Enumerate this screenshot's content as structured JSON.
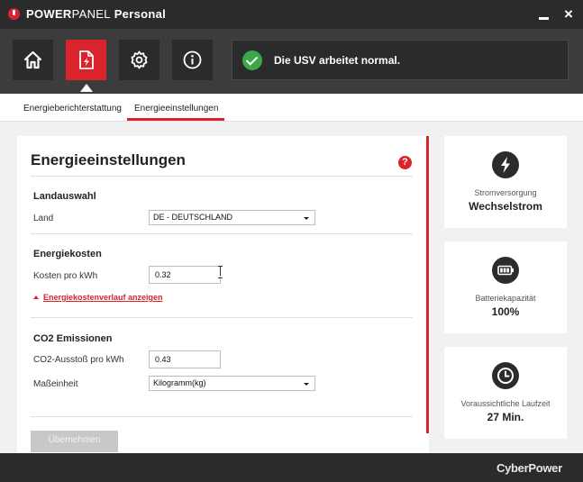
{
  "window": {
    "title_bold_1": "POWER",
    "title_regular": "PANEL",
    "title_bold_2": " Personal",
    "minimize_icon": "minimize-icon",
    "close_label": "×"
  },
  "toolbar": {
    "buttons": [
      {
        "icon": "home-icon",
        "active": false
      },
      {
        "icon": "energy-document-icon",
        "active": true
      },
      {
        "icon": "gear-icon",
        "active": false
      },
      {
        "icon": "info-icon",
        "active": false
      }
    ],
    "status_text": "Die USV arbeitet normal.",
    "status_color": "#3ca648"
  },
  "tabs": [
    {
      "label": "Energieberichterstattung",
      "active": false
    },
    {
      "label": "Energieeinstellungen",
      "active": true
    }
  ],
  "panel": {
    "title": "Energieeinstellungen",
    "help_label": "?",
    "country": {
      "section_title": "Landauswahl",
      "field_label": "Land",
      "selected": "DE - DEUTSCHLAND"
    },
    "costs": {
      "section_title": "Energiekosten",
      "field_label": "Kosten pro kWh",
      "value": "0.32",
      "history_link": "Energiekostenverlauf anzeigen"
    },
    "co2": {
      "section_title": "CO2 Emissionen",
      "field_label": "CO2-Ausstoß pro kWh",
      "value": "0.43",
      "unit_label": "Maßeinheit",
      "unit_selected": "Kilogramm(kg)"
    },
    "apply_label": "Übernehmen"
  },
  "cards": [
    {
      "icon": "lightning-icon",
      "label": "Stromversorgung",
      "value": "Wechselstrom"
    },
    {
      "icon": "battery-icon",
      "label": "Batteriekapazität",
      "value": "100%"
    },
    {
      "icon": "clock-icon",
      "label": "Voraussichtliche Laufzeit",
      "value": "27 Min."
    }
  ],
  "footer": {
    "brand": "CyberPower"
  },
  "colors": {
    "accent": "#d9232d",
    "dark": "#2b2b2b",
    "toolbar": "#3c3c3c"
  }
}
